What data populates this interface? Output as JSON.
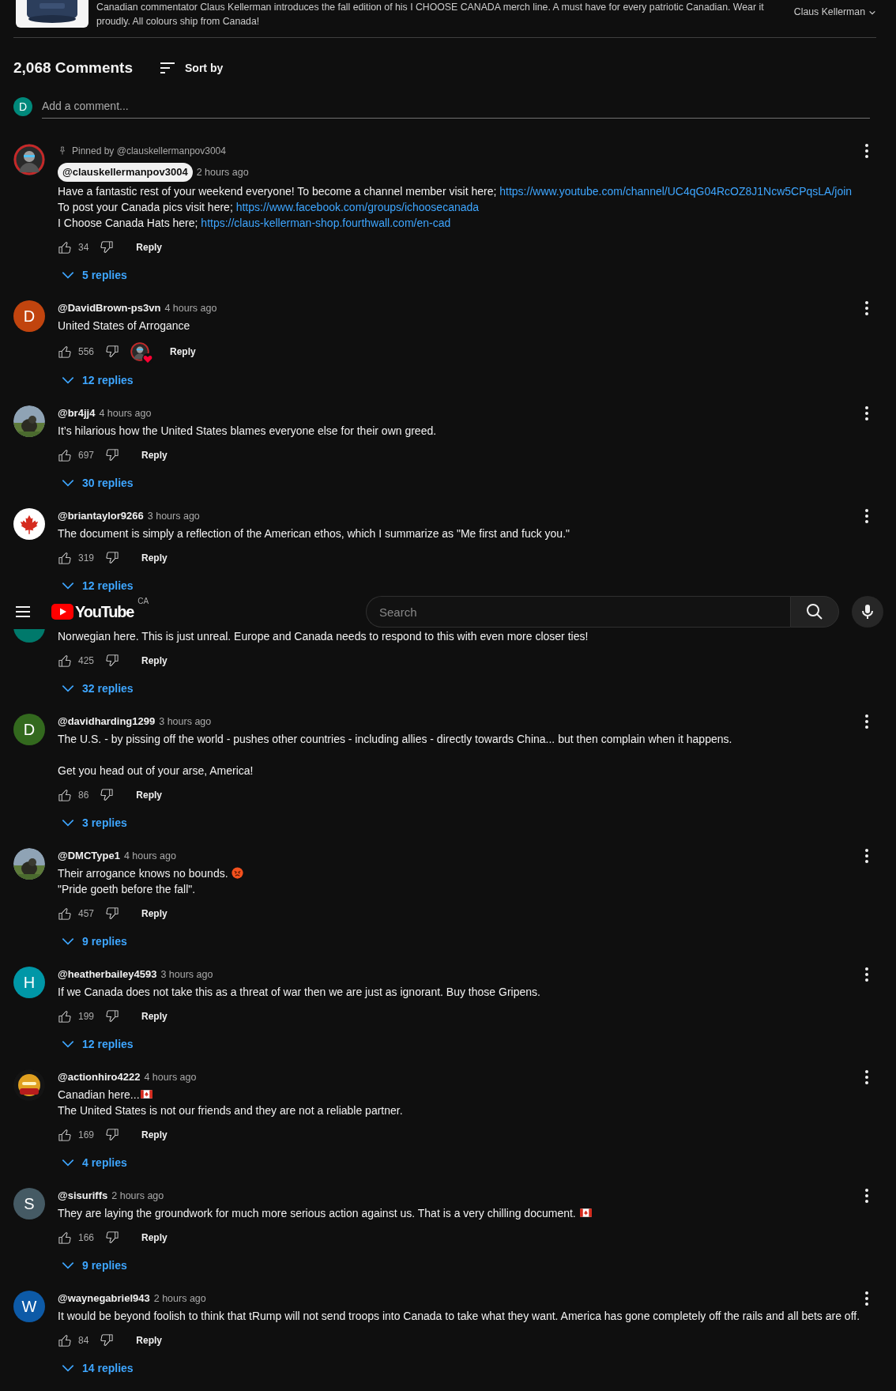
{
  "product": {
    "description": "Canadian commentator Claus Kellerman introduces the fall edition of his I CHOOSE CANADA merch line. A must have for every patriotic Canadian. Wear it proudly. All colours ship from Canada!",
    "seller": "Claus Kellerman"
  },
  "comments_header": {
    "count": "2,068 Comments",
    "sort_label": "Sort by"
  },
  "add_comment": {
    "avatar": {
      "letter": "D",
      "color": "#00897b"
    },
    "placeholder": "Add a comment..."
  },
  "comments": [
    {
      "avatar": {
        "kind": "picture"
      },
      "pinned_by": "Pinned by @clauskellermanpov3004",
      "author": "@clauskellermanpov3004",
      "creator": true,
      "time": "2 hours ago",
      "body": [
        {
          "text": "Have a fantastic rest of your weekend everyone! To become a channel member visit here; "
        },
        {
          "link": "https://www.youtube.com/channel/UC4qG04RcOZ8J1Ncw5CPqsLA/join"
        },
        {
          "text": "\nTo post your Canada pics visit here; "
        },
        {
          "link": "https://www.facebook.com/groups/ichoosecanada"
        },
        {
          "text": "\nI Choose Canada Hats here; "
        },
        {
          "link": "https://claus-kellerman-shop.fourthwall.com/en-cad"
        }
      ],
      "likes": "34",
      "hearted": false,
      "reply_label": "Reply",
      "replies": "5 replies"
    },
    {
      "avatar": {
        "kind": "letter",
        "letter": "D",
        "color": "#c1440e"
      },
      "author": "@DavidBrown-ps3vn",
      "creator": false,
      "time": "4 hours ago",
      "body": [
        {
          "text": "United States of Arrogance"
        }
      ],
      "likes": "556",
      "hearted": true,
      "reply_label": "Reply",
      "replies": "12 replies"
    },
    {
      "avatar": {
        "kind": "picture"
      },
      "author": "@br4jj4",
      "creator": false,
      "time": "4 hours ago",
      "body": [
        {
          "text": "It’s hilarious how the United States blames everyone else for their own greed."
        }
      ],
      "likes": "697",
      "hearted": false,
      "reply_label": "Reply",
      "replies": "30 replies"
    },
    {
      "avatar": {
        "kind": "leaf"
      },
      "author": "@briantaylor9266",
      "creator": false,
      "time": "3 hours ago",
      "body": [
        {
          "text": "The document is simply a reflection of the American ethos, which I summarize as \"Me first and fuck you.\""
        }
      ],
      "likes": "319",
      "hearted": false,
      "reply_label": "Reply",
      "replies": "12 replies"
    },
    {
      "avatar": {
        "kind": "letter",
        "color": "#00796b"
      },
      "body": [
        {
          "text": "Norwegian here. This is just unreal. Europe and Canada needs to respond to this with even more closer ties!"
        }
      ],
      "likes": "425",
      "hearted": false,
      "reply_label": "Reply",
      "replies": "32 replies"
    },
    {
      "avatar": {
        "kind": "letter",
        "letter": "D",
        "color": "#33691e"
      },
      "author": "@davidharding1299",
      "creator": false,
      "time": "3 hours ago",
      "body": [
        {
          "text": "The U.S. - by pissing off the world - pushes other countries - including allies - directly towards China... but then complain when it happens.\n\nGet you head out of your arse, America!"
        }
      ],
      "likes": "86",
      "hearted": false,
      "reply_label": "Reply",
      "replies": "3 replies"
    },
    {
      "avatar": {
        "kind": "picture"
      },
      "author": "@DMCType1",
      "creator": false,
      "time": "4 hours ago",
      "body": [
        {
          "text": "Their arrogance knows no bounds. "
        },
        {
          "kind": "angry"
        },
        {
          "text": "\n\"Pride goeth before the fall\"."
        }
      ],
      "likes": "457",
      "hearted": false,
      "reply_label": "Reply",
      "replies": "9 replies"
    },
    {
      "avatar": {
        "kind": "letter",
        "letter": "H",
        "color": "#0097a7"
      },
      "author": "@heatherbailey4593",
      "creator": false,
      "time": "3 hours ago",
      "body": [
        {
          "text": "If we Canada does not take this as a threat of war then we are just as ignorant. Buy those Gripens."
        }
      ],
      "likes": "199",
      "hearted": false,
      "reply_label": "Reply",
      "replies": "12 replies"
    },
    {
      "avatar": {
        "kind": "picture"
      },
      "author": "@actionhiro4222",
      "creator": false,
      "time": "4 hours ago",
      "body": [
        {
          "text": "Canadian here..."
        },
        {
          "kind": "flag"
        },
        {
          "text": "\nThe United States is not our friends and they are not a reliable partner."
        }
      ],
      "likes": "169",
      "hearted": false,
      "reply_label": "Reply",
      "replies": "4 replies"
    },
    {
      "avatar": {
        "kind": "letter",
        "letter": "S",
        "color": "#455a64"
      },
      "author": "@sisuriffs",
      "creator": false,
      "time": "2 hours ago",
      "body": [
        {
          "text": "They are laying the groundwork for much more serious action against us. That is a very chilling document. "
        },
        {
          "kind": "flag"
        }
      ],
      "likes": "166",
      "hearted": false,
      "reply_label": "Reply",
      "replies": "9 replies"
    },
    {
      "avatar": {
        "kind": "letter",
        "letter": "W",
        "color": "#0d5aa7"
      },
      "author": "@waynegabriel943",
      "creator": false,
      "time": "2 hours ago",
      "body": [
        {
          "text": "It would be beyond foolish to think that tRump will not send troops into Canada to take what they want. America has gone completely off the rails and all bets are off."
        }
      ],
      "likes": "84",
      "hearted": false,
      "reply_label": "Reply",
      "replies": "14 replies"
    }
  ],
  "masthead": {
    "logo_text": "YouTube",
    "region": "CA",
    "search_placeholder": "Search"
  }
}
